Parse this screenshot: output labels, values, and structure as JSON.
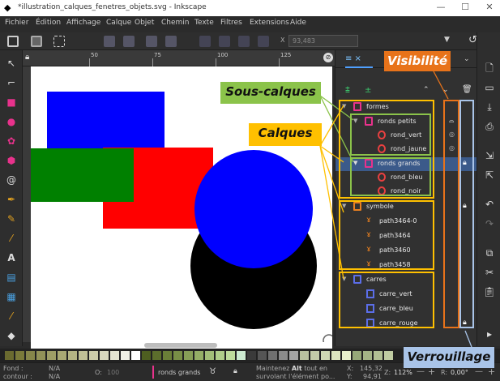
{
  "window": {
    "title": "*illustration_calques_fenetres_objets.svg - Inkscape",
    "minimize": "—",
    "maximize": "☐",
    "close": "✕"
  },
  "menu": [
    "Fichier",
    "Édition",
    "Affichage",
    "Calque",
    "Objet",
    "Chemin",
    "Texte",
    "Filtres",
    "Extensions",
    "Aide"
  ],
  "toolbar": {
    "x_label": "X",
    "x_value": "93,483"
  },
  "rulers": {
    "top_marks": [
      "50",
      "75",
      "100",
      "125"
    ]
  },
  "panel": {
    "tab_label": "≡ ×",
    "rows": [
      {
        "label": "formes",
        "type": "layer",
        "level": 0,
        "expanded": true,
        "locked": false,
        "hidden": false
      },
      {
        "label": "ronds petits",
        "type": "layer",
        "level": 1,
        "expanded": true,
        "locked": false,
        "hidden": true
      },
      {
        "label": "rond_vert",
        "type": "circle",
        "level": 2
      },
      {
        "label": "rond_jaune",
        "type": "circle",
        "level": 2
      },
      {
        "label": "ronds grands",
        "type": "layer",
        "level": 1,
        "expanded": true,
        "locked": true,
        "selected": true
      },
      {
        "label": "rond_bleu",
        "type": "circle",
        "level": 2
      },
      {
        "label": "rond_noir",
        "type": "circle",
        "level": 2
      },
      {
        "label": "symbole",
        "type": "layer",
        "level": 0,
        "expanded": true,
        "locked": true
      },
      {
        "label": "path3464-0",
        "type": "path",
        "level": 1
      },
      {
        "label": "path3464",
        "type": "path",
        "level": 1
      },
      {
        "label": "path3460",
        "type": "path",
        "level": 1
      },
      {
        "label": "path3458",
        "type": "path",
        "level": 1
      },
      {
        "label": "carres",
        "type": "layer",
        "level": 0,
        "expanded": true,
        "locked": false
      },
      {
        "label": "carre_vert",
        "type": "rect",
        "level": 1
      },
      {
        "label": "carre_bleu",
        "type": "rect",
        "level": 1
      },
      {
        "label": "carre_rouge",
        "type": "rect",
        "level": 1,
        "locked": true
      }
    ]
  },
  "callouts": {
    "visibilite": "Visibilité",
    "sous_calques": "Sous-calques",
    "calques": "Calques",
    "verrouillage": "Verrouillage"
  },
  "status": {
    "fond_label": "Fond :",
    "fond_value": "N/A",
    "contour_label": "contour :",
    "contour_value": "N/A",
    "opacity_label": "O:",
    "opacity_value": "100",
    "layer_name": "ronds grands",
    "message_a": "Maintenez ",
    "message_bold": "Alt",
    "message_b": " tout en",
    "message_2": "survolant l'élément po...",
    "x_label": "X:",
    "x_value": "145,32",
    "y_label": "Y:",
    "y_value": "94,91",
    "zoom_label": "Z:",
    "zoom_value": "112%",
    "rot_label": "R:",
    "rot_value": "0,00°"
  },
  "colors": {
    "blue": "#0000ff",
    "red": "#ff0000",
    "green": "#008000",
    "black": "#000000",
    "orange_callout": "#e8731a",
    "green_callout": "#8bc34a",
    "yellow_callout": "#ffc000",
    "blue_callout": "#a9c4e8"
  }
}
